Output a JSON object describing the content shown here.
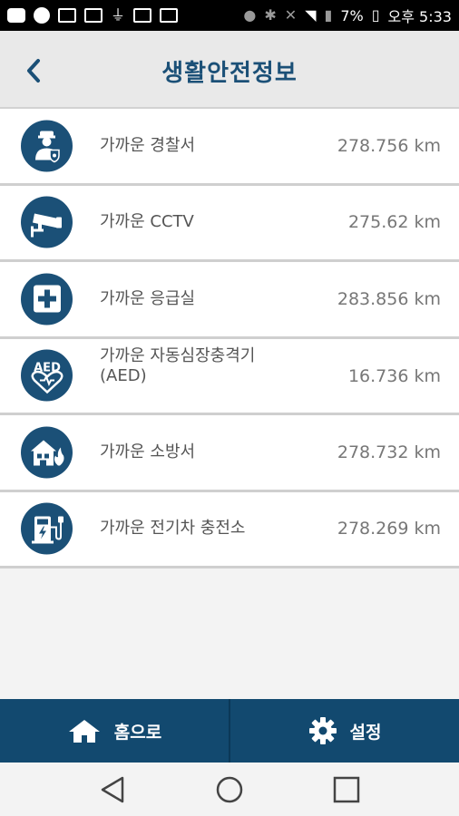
{
  "status_bar": {
    "battery": "7%",
    "time": "오후 5:33"
  },
  "header": {
    "title": "생활안전정보"
  },
  "items": [
    {
      "label": "가까운 경찰서",
      "distance": "278.756 km",
      "icon": "police-icon"
    },
    {
      "label": "가까운 CCTV",
      "distance": "275.62 km",
      "icon": "cctv-icon"
    },
    {
      "label": "가까운 응급실",
      "distance": "283.856 km",
      "icon": "emergency-room-icon"
    },
    {
      "label_line1": "가까운 자동심장충격기",
      "label_line2": "(AED)",
      "distance": "16.736 km",
      "icon": "aed-icon",
      "icon_text": "AED"
    },
    {
      "label": "가까운 소방서",
      "distance": "278.732 km",
      "icon": "fire-station-icon"
    },
    {
      "label": "가까운 전기차 충전소",
      "distance": "278.269 km",
      "icon": "ev-charger-icon"
    }
  ],
  "bottom_nav": {
    "home_label": "홈으로",
    "settings_label": "설정"
  },
  "colors": {
    "primary": "#1b5077",
    "nav_bar": "#12496f"
  }
}
